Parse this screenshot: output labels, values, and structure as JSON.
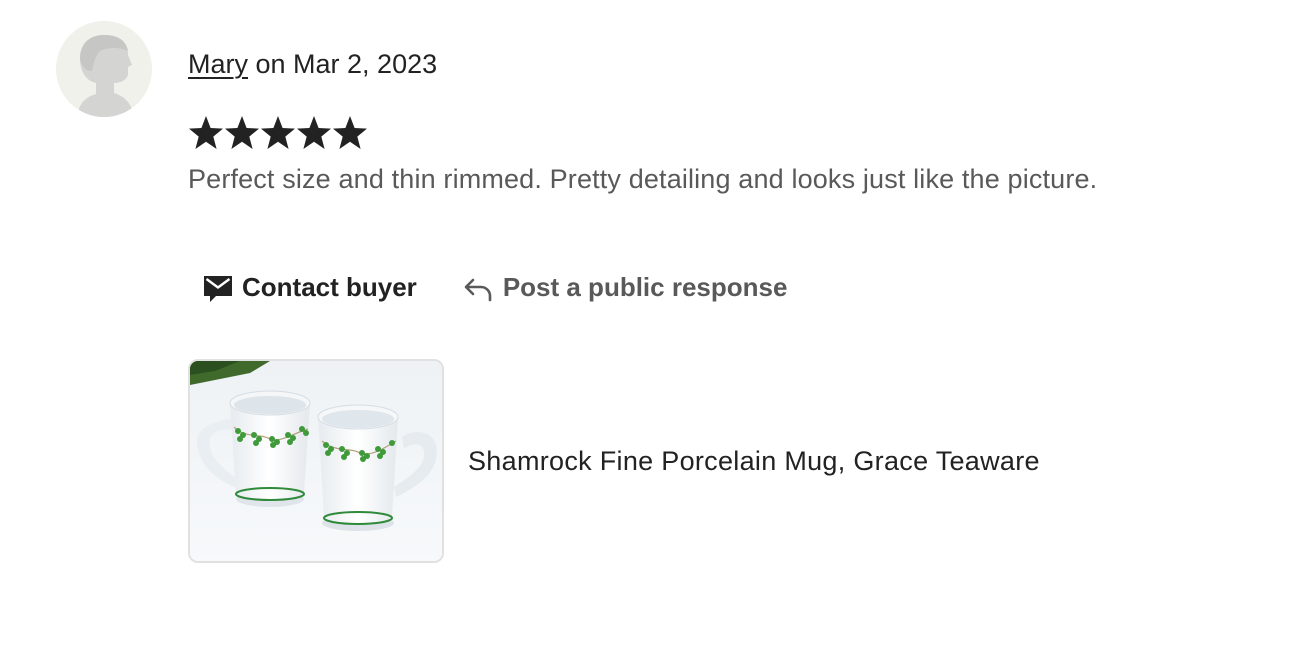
{
  "review": {
    "reviewer_name": "Mary",
    "date_text": " on Mar 2, 2023",
    "rating": 5,
    "rating_max": 5,
    "text": "Perfect size and thin rimmed. Pretty detailing and looks just like the picture."
  },
  "actions": {
    "contact_label": "Contact buyer",
    "contact_icon": "envelope-icon",
    "respond_label": "Post a public response",
    "respond_icon": "reply-arrow-icon"
  },
  "product": {
    "title": "Shamrock Fine Porcelain Mug, Grace Teaware"
  },
  "colors": {
    "star": "#222222",
    "secondary_text": "#595959",
    "avatar_bg": "#f1f1ec"
  }
}
